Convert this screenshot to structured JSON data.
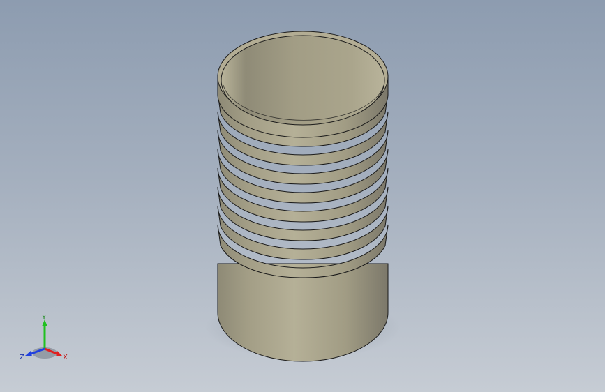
{
  "viewport": {
    "background_top": "#8d9cb0",
    "background_bottom": "#c6ccd4"
  },
  "model": {
    "type": "ribbed cylindrical tube (hose barb fitting)",
    "body_color": "#a9a38a",
    "edge_color": "#1a1a1a",
    "rib_count": 9
  },
  "triad": {
    "x_label": "X",
    "y_label": "Y",
    "z_label": "Z",
    "x_color": "#e02020",
    "y_color": "#20c020",
    "z_color": "#2040e0"
  }
}
